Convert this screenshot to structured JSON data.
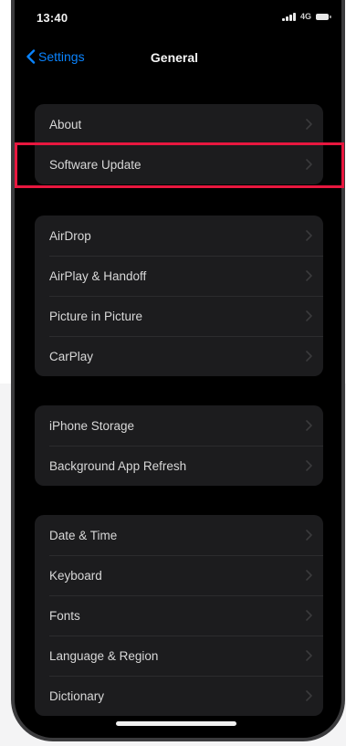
{
  "status_bar": {
    "time": "13:40",
    "network": "4G"
  },
  "nav": {
    "back_label": "Settings",
    "title": "General"
  },
  "groups": [
    {
      "items": [
        {
          "label": "About"
        },
        {
          "label": "Software Update"
        }
      ]
    },
    {
      "items": [
        {
          "label": "AirDrop"
        },
        {
          "label": "AirPlay & Handoff"
        },
        {
          "label": "Picture in Picture"
        },
        {
          "label": "CarPlay"
        }
      ]
    },
    {
      "items": [
        {
          "label": "iPhone Storage"
        },
        {
          "label": "Background App Refresh"
        }
      ]
    },
    {
      "items": [
        {
          "label": "Date & Time"
        },
        {
          "label": "Keyboard"
        },
        {
          "label": "Fonts"
        },
        {
          "label": "Language & Region"
        },
        {
          "label": "Dictionary"
        }
      ]
    }
  ],
  "icons": {
    "back": "chevron-left-icon",
    "row": "chevron-right-icon",
    "signal": "signal-icon",
    "battery": "battery-icon"
  },
  "colors": {
    "accent": "#0a84ff",
    "highlight": "#e8173f",
    "background": "#000000",
    "group_background": "#1c1c1e"
  }
}
